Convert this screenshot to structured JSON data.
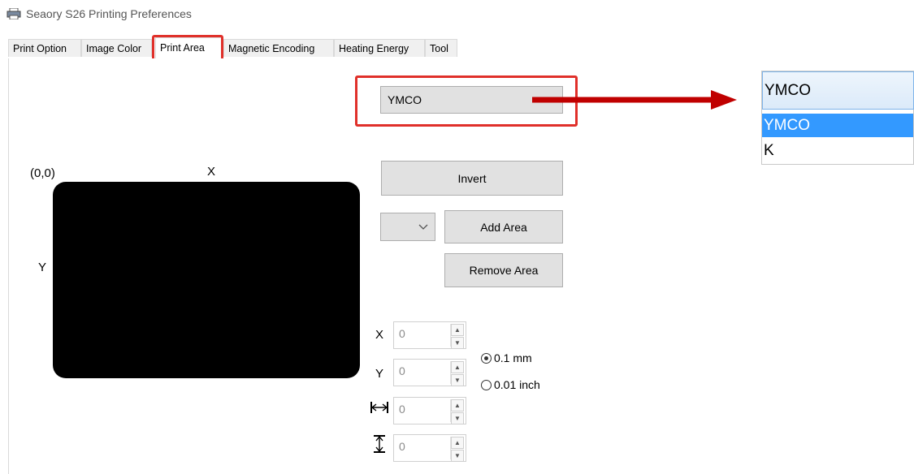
{
  "window": {
    "title": "Seaory S26 Printing Preferences",
    "icon": "printer-icon"
  },
  "tabs": [
    {
      "label": "Print Option"
    },
    {
      "label": "Image Color"
    },
    {
      "label": "Print Area",
      "active": true
    },
    {
      "label": "Magnetic Encoding"
    },
    {
      "label": "Heating Energy"
    },
    {
      "label": "Tool"
    }
  ],
  "print_area": {
    "ribbon_select": {
      "value": "YMCO"
    },
    "origin_label": "(0,0)",
    "x_axis_label": "X",
    "y_axis_label": "Y",
    "card_color": "#000000",
    "invert_label": "Invert",
    "area_select": {
      "value": ""
    },
    "add_area_label": "Add Area",
    "remove_area_label": "Remove Area",
    "fields": {
      "x": {
        "label": "X",
        "value": "0"
      },
      "y": {
        "label": "Y",
        "value": "0"
      },
      "width": {
        "icon": "width-arrows-icon",
        "value": "0"
      },
      "height": {
        "icon": "height-arrows-icon",
        "value": "0"
      }
    },
    "units": [
      {
        "label": "0.1 mm",
        "checked": true
      },
      {
        "label": "0.01 inch",
        "checked": false
      }
    ]
  },
  "dropdown_zoom": {
    "selected": "YMCO",
    "options": [
      "YMCO",
      "K"
    ],
    "highlight_color": "#3399ff"
  },
  "annotation_color": "#e0302a",
  "arrow_color": "#c00000"
}
